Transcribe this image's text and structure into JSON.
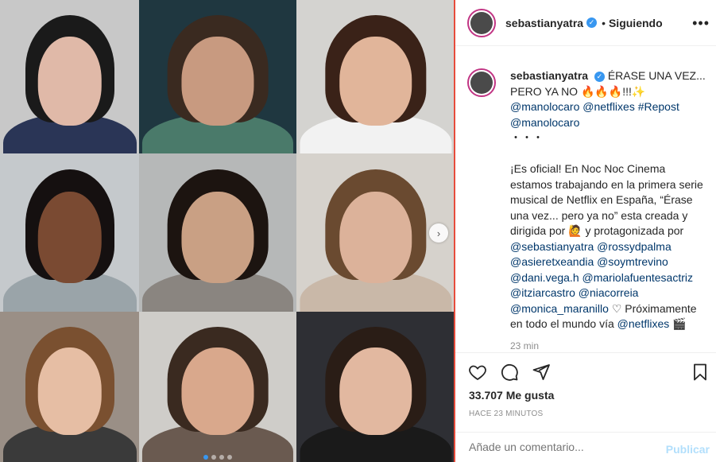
{
  "post": {
    "username": "sebastianyatra",
    "follow_separator": "•",
    "follow_status": "Siguiendo",
    "more_label": "•••"
  },
  "caption": {
    "username": "sebastianyatra",
    "line1": "ÉRASE UNA VEZ...",
    "line2": "PERO YA NO 🔥🔥🔥!!!✨",
    "mentions_line": "@manolocaro @netflixes #Repost @manolocaro",
    "dots": "・・・",
    "body": "¡Es oficial! En Noc Noc Cinema estamos trabajando en la primera serie musical de Netflix en España, “Érase una vez... pero ya no” esta creada y dirigida por 🙋 y protagonizada por",
    "handles": "@sebastianyatra @rossydpalma @asieretxeandia @soymtrevino @dani.vega.h @mariolafuentesactriz @itziarcastro @niacorreia @monica_maranillo",
    "heart": "♡",
    "closing": "Próximamente en todo el mundo vía",
    "closing_handle": "@netflixes",
    "time_short": "23 min"
  },
  "stats": {
    "likes": "33.707 Me gusta",
    "ago": "HACE 23 MINUTOS"
  },
  "comment_box": {
    "placeholder": "Añade un comentario...",
    "publish": "Publicar"
  },
  "media": {
    "carousel_dots": 4,
    "active_dot": 0,
    "tiles": [
      {
        "bg": "#c8c8c8",
        "skin": "#e0b9a8",
        "hair": "#1a1a1a",
        "top": "#2a3556"
      },
      {
        "bg": "#1f3740",
        "skin": "#c89a80",
        "hair": "#3a2a20",
        "top": "#4a7a6a"
      },
      {
        "bg": "#d4d3d0",
        "skin": "#e1b59a",
        "hair": "#3a2218",
        "top": "#f2f2f2"
      },
      {
        "bg": "#c5c9cc",
        "skin": "#7a4a32",
        "hair": "#151010",
        "top": "#9aa4a9"
      },
      {
        "bg": "#b6b8b8",
        "skin": "#c9a084",
        "hair": "#1c1410",
        "top": "#8a8580"
      },
      {
        "bg": "#d6d2cc",
        "skin": "#dcb29a",
        "hair": "#6a4a30",
        "top": "#c9b8a8"
      },
      {
        "bg": "#9a8f86",
        "skin": "#e6bea4",
        "hair": "#7a5030",
        "top": "#3a3a3a"
      },
      {
        "bg": "#cfcdc9",
        "skin": "#d9a88c",
        "hair": "#3a2a20",
        "top": "#6a5a50"
      },
      {
        "bg": "#2e2f34",
        "skin": "#e2b8a0",
        "hair": "#2a1d16",
        "top": "#1a1a1a"
      }
    ]
  }
}
